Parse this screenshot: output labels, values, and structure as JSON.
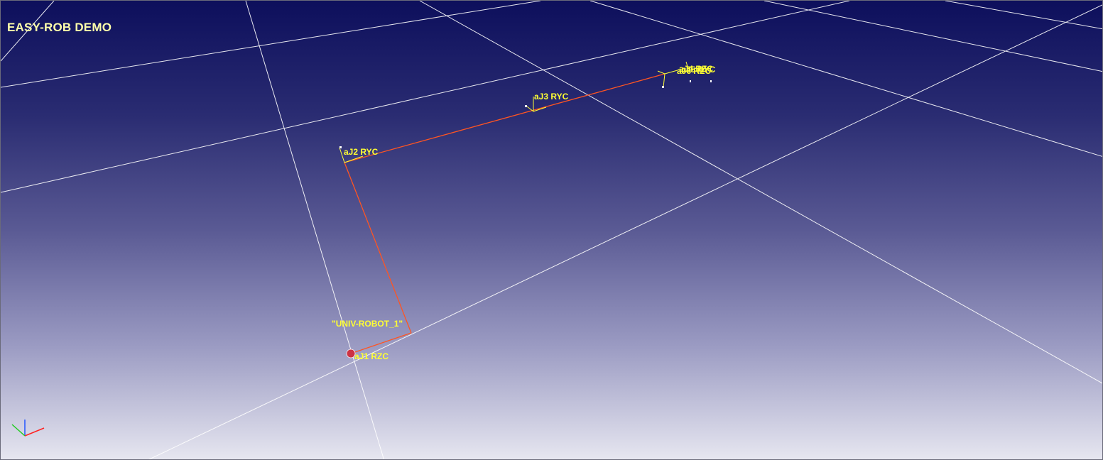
{
  "viewport": {
    "title": "EASY-ROB DEMO",
    "background_colors": [
      "#0d0f5c",
      "#5a5a94",
      "#e6e6f0"
    ]
  },
  "robot": {
    "name": "\"UNIV-ROBOT_1\"",
    "link_color": "#ff5522",
    "label_color": "#ffff33",
    "joints": [
      {
        "label": "aJ1 RZC"
      },
      {
        "label": "aJ2 RYC"
      },
      {
        "label": "aJ3 RYC"
      },
      {
        "label": "aJ4 RZC"
      },
      {
        "label": "aJ5 RYC"
      },
      {
        "label": "aJ6 RZC"
      }
    ]
  },
  "axes": {
    "x_color": "#ff2222",
    "y_color": "#22cc22",
    "z_color": "#2255ff"
  }
}
